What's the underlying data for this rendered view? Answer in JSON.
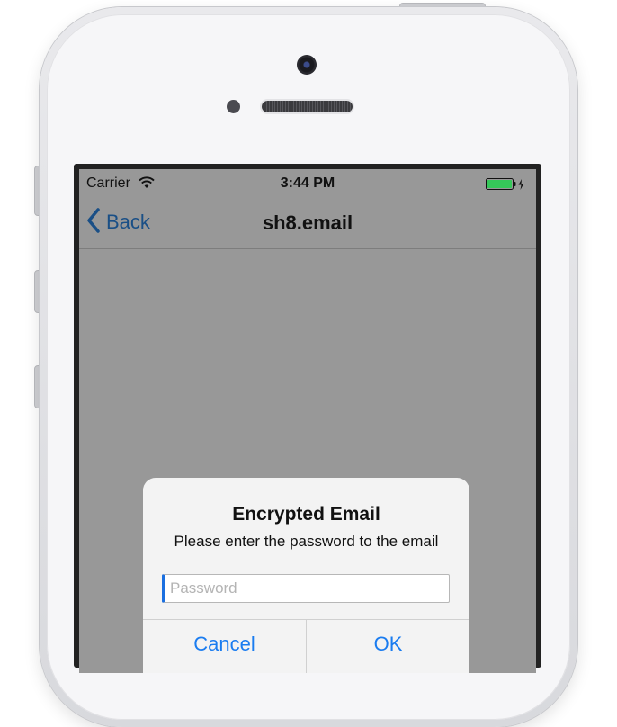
{
  "status_bar": {
    "carrier": "Carrier",
    "time": "3:44 PM",
    "battery_color": "#35c759"
  },
  "nav": {
    "back_label": "Back",
    "title": "sh8.email",
    "tint": "#1a4f86"
  },
  "alert": {
    "title": "Encrypted Email",
    "message": "Please enter the password to the email",
    "password_placeholder": "Password",
    "password_value": "",
    "cancel_label": "Cancel",
    "ok_label": "OK",
    "button_color": "#1a7cf0"
  },
  "colors": {
    "screen_dim": "#989898",
    "alert_bg": "#f3f3f3",
    "device": "#f6f6f8"
  },
  "icons": [
    "wifi-icon",
    "battery-icon",
    "chevron-left-icon",
    "camera-icon",
    "speaker-icon"
  ]
}
